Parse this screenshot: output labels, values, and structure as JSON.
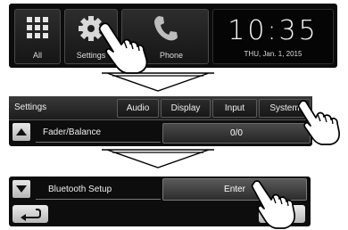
{
  "home_screen": {
    "tiles": [
      {
        "label": "All",
        "icon": "grid-icon"
      },
      {
        "label": "Settings",
        "icon": "gear-icon"
      },
      {
        "label": "Phone",
        "icon": "phone-icon"
      }
    ],
    "clock": {
      "time": "10:35",
      "date": "THU, Jan. 1, 2015"
    }
  },
  "settings_screen": {
    "title": "Settings",
    "tabs": [
      "Audio",
      "Display",
      "Input",
      "System"
    ],
    "row": {
      "label": "Fader/Balance",
      "value": "0/0",
      "icon": "up-arrow-icon"
    }
  },
  "bluetooth_screen": {
    "row": {
      "label": "Bluetooth Setup",
      "button": "Enter",
      "icon": "down-arrow-icon"
    },
    "back_icon": "return-arrow-icon"
  },
  "colors": {
    "screen_bg": "#0d0d0d",
    "button_light": "#e0e0e0",
    "text": "#f0f0f0"
  }
}
